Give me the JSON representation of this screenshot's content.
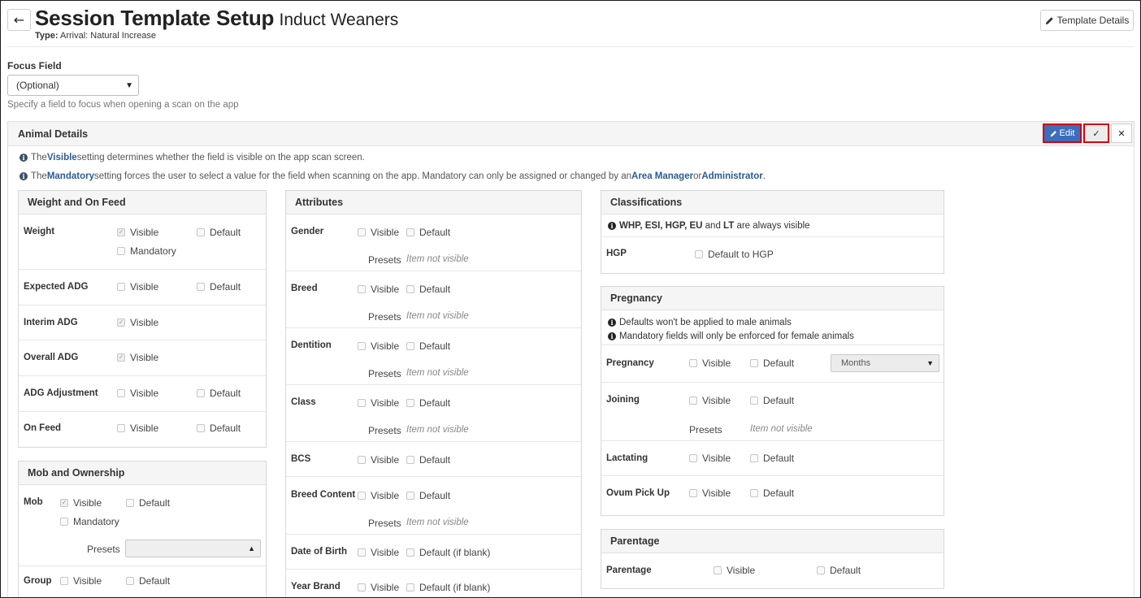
{
  "header": {
    "back_icon": "arrow-left-icon",
    "title": "Session Template Setup",
    "subtitle": "Induct Weaners",
    "type_label": "Type:",
    "type_value": "Arrival: Natural Increase",
    "template_details_label": "Template Details"
  },
  "focus": {
    "label": "Focus Field",
    "selected": "(Optional)",
    "help": "Specify a field to focus when opening a scan on the app"
  },
  "animal_details": {
    "title": "Animal Details",
    "edit_label": "Edit",
    "info1": {
      "a": "The ",
      "b": "Visible",
      "c": " setting determines whether the field is visible on the app scan screen."
    },
    "info2": {
      "a": "The ",
      "b": "Mandatory",
      "c": " setting forces the user to select a value for the field when scanning on the app. Mandatory can only be assigned or changed by an ",
      "d": "Area Manager",
      "e": " or ",
      "f": "Administrator",
      "g": "."
    }
  },
  "common": {
    "visible": "Visible",
    "default": "Default",
    "mandatory": "Mandatory",
    "presets": "Presets",
    "item_not_visible": "Item not visible",
    "default_if_blank": "Default (if blank)"
  },
  "weight_card": {
    "title": "Weight and On Feed",
    "rows": [
      {
        "label": "Weight"
      },
      {
        "label": "Expected ADG"
      },
      {
        "label": "Interim ADG"
      },
      {
        "label": "Overall ADG"
      },
      {
        "label": "ADG Adjustment"
      },
      {
        "label": "On Feed"
      }
    ]
  },
  "mob_card": {
    "title": "Mob and Ownership",
    "rows": [
      {
        "label": "Mob"
      },
      {
        "label": "Group"
      }
    ]
  },
  "attributes_card": {
    "title": "Attributes",
    "rows": [
      {
        "label": "Gender"
      },
      {
        "label": "Breed"
      },
      {
        "label": "Dentition"
      },
      {
        "label": "Class"
      },
      {
        "label": "BCS"
      },
      {
        "label": "Breed Content"
      },
      {
        "label": "Date of Birth"
      },
      {
        "label": "Year Brand"
      }
    ]
  },
  "classifications_card": {
    "title": "Classifications",
    "note_bold": "WHP, ESI, HGP, EU",
    "note_and": " and ",
    "note_bold2": "LT",
    "note_rest": " are always visible",
    "hgp_label": "HGP",
    "hgp_default": "Default to HGP"
  },
  "pregnancy_card": {
    "title": "Pregnancy",
    "note1": "Defaults won't be applied to male animals",
    "note2": "Mandatory fields will only be enforced for female animals",
    "units_selected": "Months",
    "rows": [
      {
        "label": "Pregnancy"
      },
      {
        "label": "Joining"
      },
      {
        "label": "Lactating"
      },
      {
        "label": "Ovum Pick Up"
      }
    ]
  },
  "parentage_card": {
    "title": "Parentage",
    "rows": [
      {
        "label": "Parentage"
      }
    ]
  }
}
